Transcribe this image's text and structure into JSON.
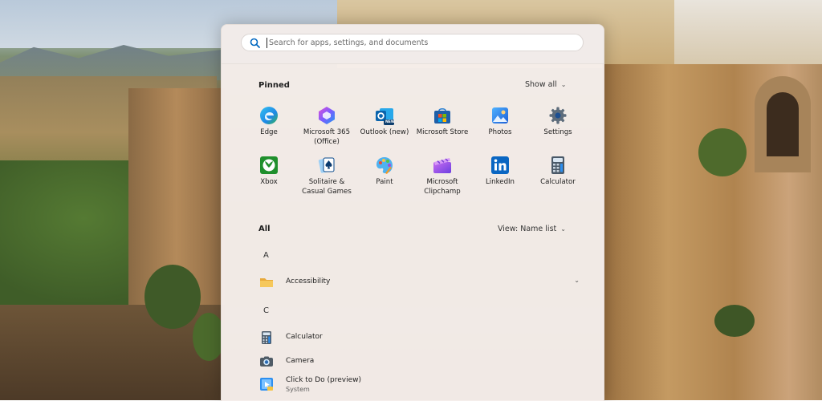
{
  "search": {
    "placeholder": "Search for apps, settings, and documents"
  },
  "pinned": {
    "title": "Pinned",
    "show_all": "Show all",
    "apps": [
      {
        "label": "Edge",
        "icon": "edge-icon"
      },
      {
        "label": "Microsoft 365 (Office)",
        "icon": "microsoft-365-icon"
      },
      {
        "label": "Outlook (new)",
        "icon": "outlook-icon"
      },
      {
        "label": "Microsoft Store",
        "icon": "store-icon"
      },
      {
        "label": "Photos",
        "icon": "photos-icon"
      },
      {
        "label": "Settings",
        "icon": "gear-icon"
      },
      {
        "label": "Xbox",
        "icon": "xbox-icon"
      },
      {
        "label": "Solitaire & Casual Games",
        "icon": "solitaire-icon"
      },
      {
        "label": "Paint",
        "icon": "paint-icon"
      },
      {
        "label": "Microsoft Clipchamp",
        "icon": "clipchamp-icon"
      },
      {
        "label": "LinkedIn",
        "icon": "linkedin-icon"
      },
      {
        "label": "Calculator",
        "icon": "calculator-icon"
      }
    ],
    "outlook_badge": "NEW"
  },
  "all": {
    "title": "All",
    "view": "View: Name list",
    "groups": [
      {
        "letter": "A",
        "items": [
          {
            "name": "Accessibility",
            "icon": "folder-icon"
          }
        ]
      },
      {
        "letter": "C",
        "items": [
          {
            "name": "Calculator",
            "icon": "calculator-icon"
          },
          {
            "name": "Camera",
            "icon": "camera-icon"
          },
          {
            "name": "Click to Do (preview)",
            "sub": "System",
            "icon": "click-to-do-icon"
          }
        ]
      }
    ]
  },
  "colors": {
    "accent": "#0067c0",
    "panel": "#f6eeeb"
  }
}
